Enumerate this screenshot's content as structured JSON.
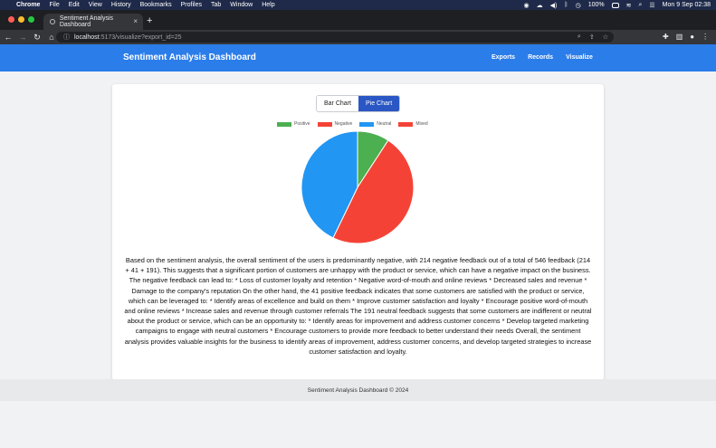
{
  "os_menubar": {
    "app_name": "Chrome",
    "items": [
      "File",
      "Edit",
      "View",
      "History",
      "Bookmarks",
      "Profiles",
      "Tab",
      "Window",
      "Help"
    ],
    "battery": "100%",
    "datetime": "Mon 9 Sep  02:38"
  },
  "browser": {
    "tab_title": "Sentiment Analysis Dashboard",
    "url_host": "localhost",
    "url_path": ":5173/visualize?export_id=25"
  },
  "app": {
    "brand": "Sentiment Analysis Dashboard",
    "nav": [
      "Exports",
      "Records",
      "Visualize"
    ]
  },
  "chart_toggle": {
    "bar_label": "Bar Chart",
    "pie_label": "Pie Chart",
    "selected": "Pie Chart"
  },
  "chart_data": {
    "type": "pie",
    "categories": [
      "Positive",
      "Negative",
      "Neutral",
      "Mixed"
    ],
    "values": [
      41,
      214,
      191,
      0
    ],
    "colors": [
      "#4caf50",
      "#f44336",
      "#2196f3",
      "#f44336"
    ],
    "legend_position": "top"
  },
  "summary": "Based on the sentiment analysis, the overall sentiment of the users is predominantly negative, with 214 negative feedback out of a total of 546 feedback (214 + 41 + 191). This suggests that a significant portion of customers are unhappy with the product or service, which can have a negative impact on the business. The negative feedback can lead to: * Loss of customer loyalty and retention * Negative word-of-mouth and online reviews * Decreased sales and revenue * Damage to the company's reputation On the other hand, the 41 positive feedback indicates that some customers are satisfied with the product or service, which can be leveraged to: * Identify areas of excellence and build on them * Improve customer satisfaction and loyalty * Encourage positive word-of-mouth and online reviews * Increase sales and revenue through customer referrals The 191 neutral feedback suggests that some customers are indifferent or neutral about the product or service, which can be an opportunity to: * Identify areas for improvement and address customer concerns * Develop targeted marketing campaigns to engage with neutral customers * Encourage customers to provide more feedback to better understand their needs Overall, the sentiment analysis provides valuable insights for the business to identify areas of improvement, address customer concerns, and develop targeted strategies to increase customer satisfaction and loyalty.",
  "footer": "Sentiment Analysis Dashboard © 2024"
}
